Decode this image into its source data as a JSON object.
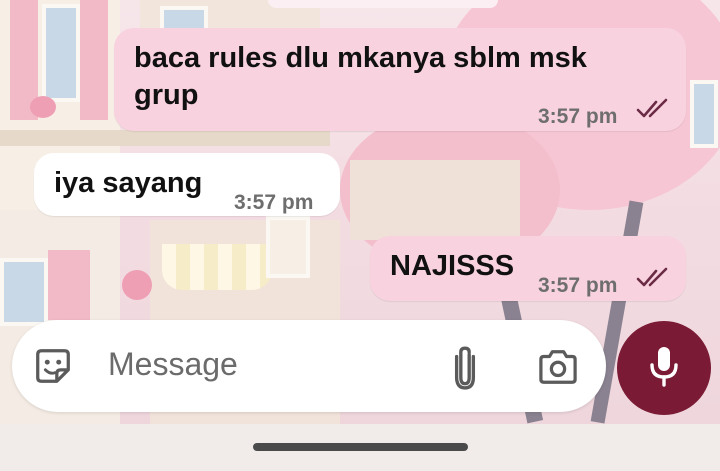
{
  "messages": [
    {
      "direction": "outgoing",
      "text": "baca rules dlu mkanya sblm msk grup",
      "time": "3:57 pm",
      "status": "read"
    },
    {
      "direction": "incoming",
      "text": "iya sayang",
      "time": "3:57 pm"
    },
    {
      "direction": "outgoing",
      "text": "NAJISSS",
      "time": "3:57 pm",
      "status": "read"
    }
  ],
  "composer": {
    "placeholder": "Message",
    "icons": [
      "sticker-icon",
      "attach-icon",
      "camera-icon",
      "microphone-icon"
    ]
  },
  "colors": {
    "outgoing_bubble": "#f9d2df",
    "incoming_bubble": "#ffffff",
    "mic_button": "#7a1a34",
    "read_ticks": "#6b2b44"
  }
}
